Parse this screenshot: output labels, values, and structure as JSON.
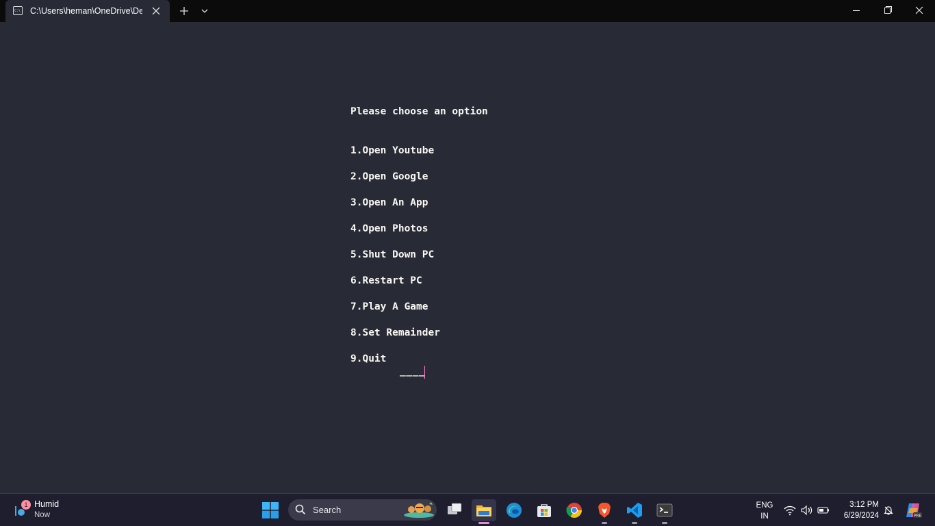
{
  "window": {
    "tab_title": "C:\\Users\\heman\\OneDrive\\De",
    "tab_icon_text": "C:\\"
  },
  "terminal": {
    "heading": "Please choose an option",
    "menu": [
      "1.Open Youtube",
      "2.Open Google",
      "3.Open An App",
      "4.Open Photos",
      "5.Shut Down PC",
      "6.Restart PC",
      "7.Play A Game",
      "8.Set Remainder",
      "9.Quit"
    ],
    "prompt": "____"
  },
  "taskbar": {
    "weather": {
      "title": "Humid",
      "subtitle": "Now",
      "badge": "1"
    },
    "search_placeholder": "Search",
    "apps": [
      "task-view",
      "file-explorer",
      "edge",
      "microsoft-store",
      "chrome",
      "brave",
      "vscode",
      "terminal"
    ],
    "language": {
      "line1": "ENG",
      "line2": "IN"
    },
    "clock": {
      "time": "3:12 PM",
      "date": "6/29/2024"
    }
  },
  "colors": {
    "terminal_bg": "#282a36",
    "terminal_fg": "#f8f8f2",
    "cursor": "#ff79c6",
    "titlebar_bg": "#0b0b0c",
    "taskbar_bg": "#1f1e2e"
  }
}
